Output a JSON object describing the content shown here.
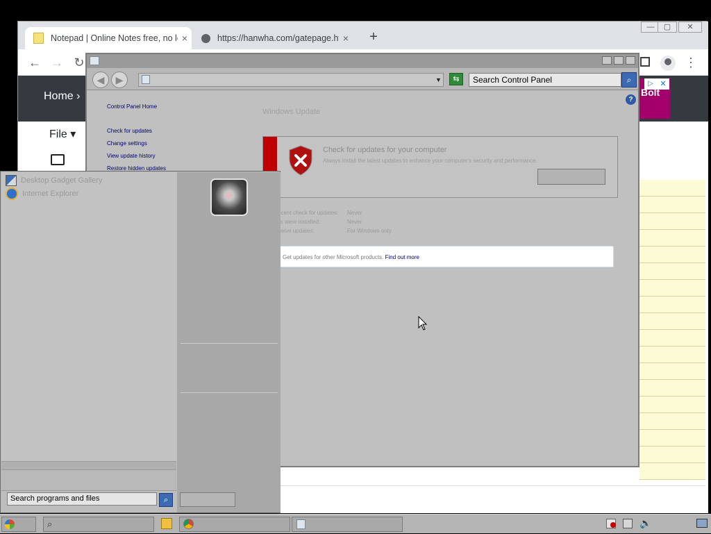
{
  "browser": {
    "tabs": [
      {
        "title": "Notepad | Online Notes free, no log",
        "close": "×"
      },
      {
        "title": "https://hanwha.com/gatepage.html",
        "close": "×"
      }
    ],
    "new_tab": "+",
    "window_controls": {
      "minimize": "—",
      "restore": "▢",
      "close": "✕"
    },
    "nav": {
      "back": "←",
      "forward": "→",
      "reload": "↻",
      "menu": "⋮"
    }
  },
  "webpage": {
    "nav_home": "Home ›",
    "file_menu": "File ▾",
    "ad": {
      "text": "Bolt",
      "close": "✕",
      "info": "▷"
    }
  },
  "control_panel": {
    "address_placeholder": "",
    "search_placeholder": "Search Control Panel",
    "help": "?",
    "sidebar_links": [
      "Control Panel Home",
      "Check for updates",
      "Change settings",
      "View update history",
      "Restore hidden updates"
    ],
    "heading": "Windows Update",
    "status_title": "Check for updates for your computer",
    "status_subtitle": "Always install the latest updates to enhance your computer's security and performance.",
    "info_rows": [
      {
        "label": "Most recent check for updates:",
        "value": "Never"
      },
      {
        "label": "Updates were installed:",
        "value": "Never"
      },
      {
        "label": "You receive updates:",
        "value": "For Windows only."
      }
    ],
    "info_bar_text": "Get updates for other Microsoft products.",
    "info_bar_link": "Find out more"
  },
  "start_menu": {
    "items": [
      {
        "label": "Desktop Gadget Gallery",
        "icon": "gadget-icon"
      },
      {
        "label": "Internet Explorer",
        "icon": "ie-icon"
      }
    ],
    "search_placeholder": "Search programs and files"
  },
  "colors": {
    "accent_red": "#c00000",
    "search_blue": "#3c6ab5",
    "ad_magenta": "#a3006b",
    "notepad_yellow": "#fdfbd6"
  }
}
